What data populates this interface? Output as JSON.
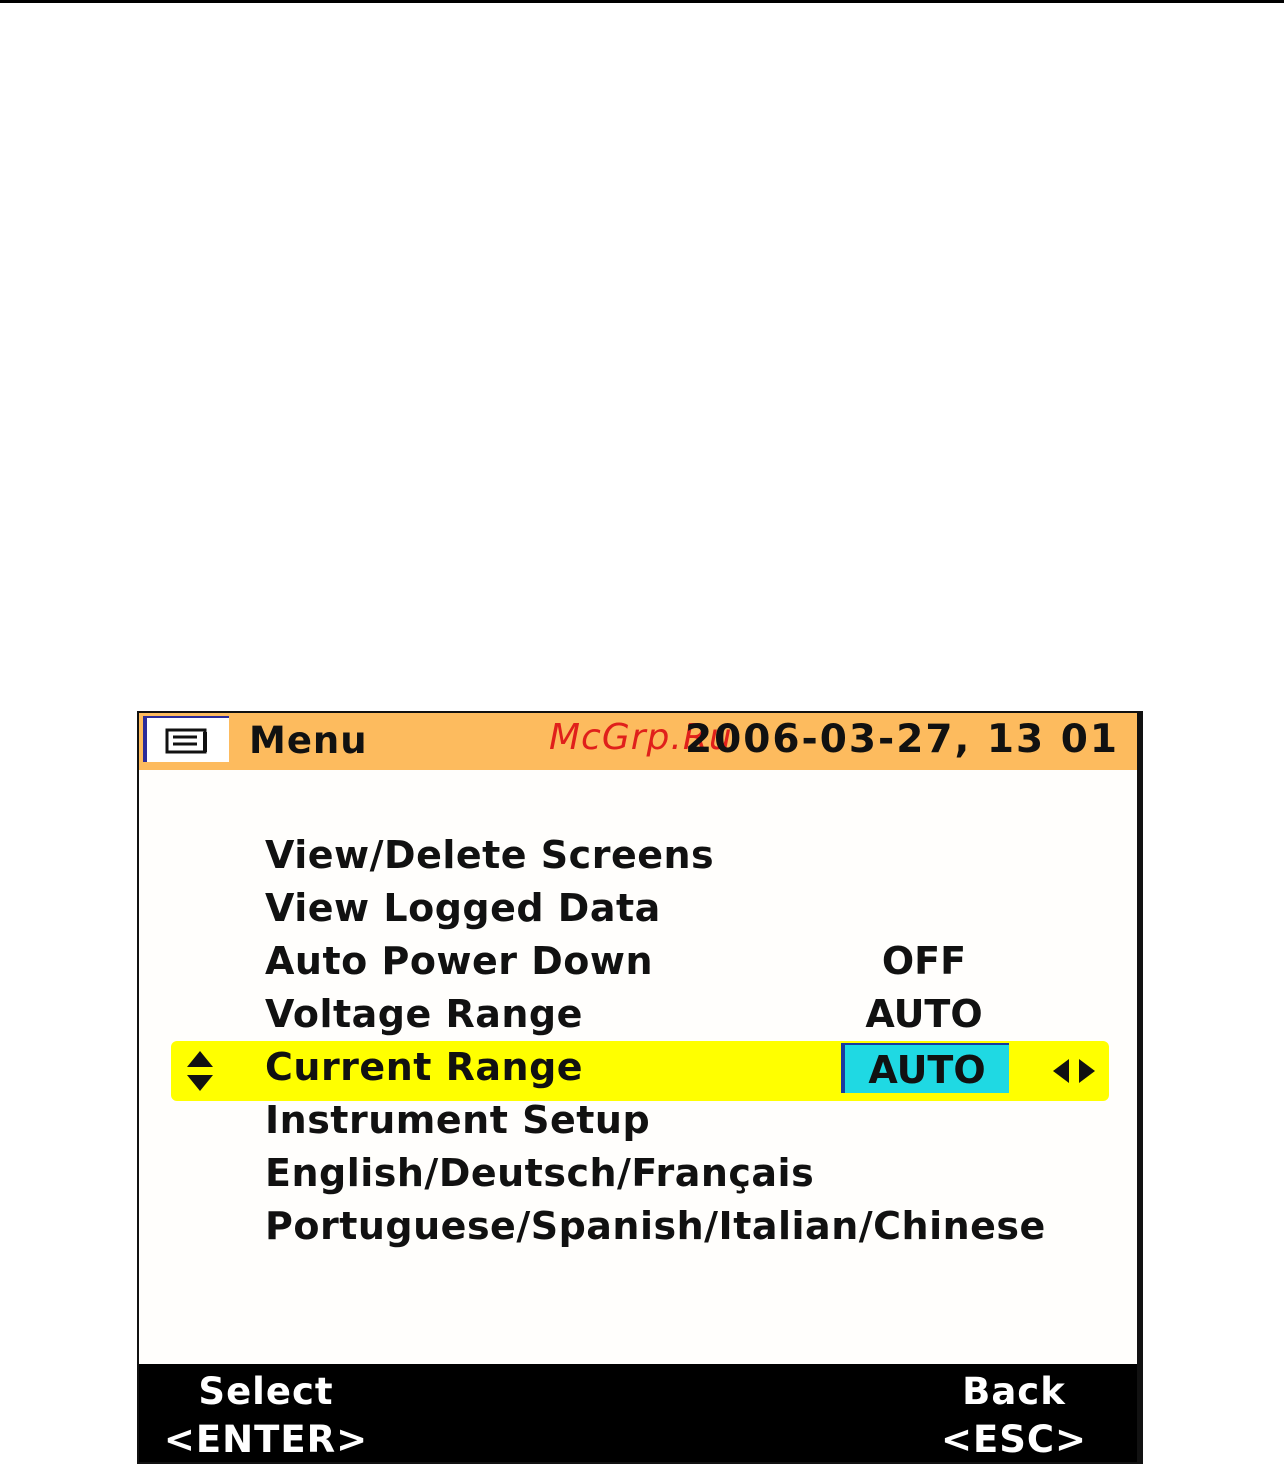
{
  "header": {
    "title": "Menu",
    "datetime": "2006-03-27, 13 01",
    "watermark": "McGrp.Ru"
  },
  "menu_items": [
    {
      "label": "View/Delete Screens",
      "value": ""
    },
    {
      "label": "View Logged Data",
      "value": ""
    },
    {
      "label": "Auto Power Down",
      "value": "OFF"
    },
    {
      "label": "Voltage Range",
      "value": "AUTO"
    },
    {
      "label": "Current Range",
      "value": "AUTO",
      "selected": true
    },
    {
      "label": "Instrument Setup",
      "value": ""
    },
    {
      "label": "English/Deutsch/Français",
      "value": ""
    },
    {
      "label": "Portuguese/Spanish/Italian/Chinese",
      "value": ""
    }
  ],
  "footer": {
    "select_label": "Select",
    "select_key": "<ENTER>",
    "back_label": "Back",
    "back_key": "<ESC>"
  },
  "colors": {
    "header_bg": "#fdbb5e",
    "selection_bg": "#ffff00",
    "value_highlight": "#1fd9e3",
    "footer_bg": "#000000",
    "watermark": "#e0201b"
  },
  "icons": {
    "menu": "menu-screen-icon",
    "updown": "up-down-arrows-icon",
    "leftright": "left-right-arrows-icon"
  }
}
